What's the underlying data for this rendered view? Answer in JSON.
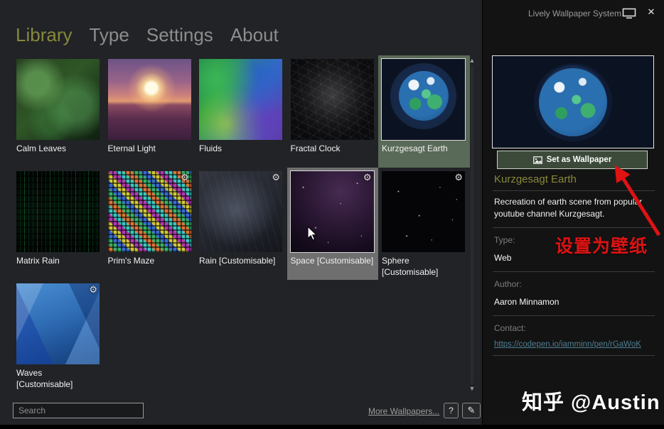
{
  "window": {
    "title": "Lively Wallpaper System"
  },
  "tabs": [
    {
      "label": "Library",
      "active": true
    },
    {
      "label": "Type",
      "active": false
    },
    {
      "label": "Settings",
      "active": false
    },
    {
      "label": "About",
      "active": false
    }
  ],
  "library": {
    "wallpapers": [
      {
        "name": "Calm Leaves",
        "style": "calm-leaves",
        "gear": false,
        "state": ""
      },
      {
        "name": "Eternal Light",
        "style": "eternal-light",
        "gear": false,
        "state": ""
      },
      {
        "name": "Fluids",
        "style": "fluids",
        "gear": false,
        "state": ""
      },
      {
        "name": "Fractal Clock",
        "style": "fractal-clock",
        "gear": false,
        "state": ""
      },
      {
        "name": "Kurzgesagt Earth",
        "style": "earth",
        "gear": false,
        "state": "selected"
      },
      {
        "name": "Matrix Rain",
        "style": "matrix-rain",
        "gear": false,
        "state": ""
      },
      {
        "name": "Prim's Maze",
        "style": "prims-maze",
        "gear": true,
        "state": ""
      },
      {
        "name": "Rain [Customisable]",
        "style": "rain",
        "gear": true,
        "state": ""
      },
      {
        "name": "Space [Customisable]",
        "style": "space",
        "gear": true,
        "state": "hover"
      },
      {
        "name": "Sphere [Customisable]",
        "style": "sphere",
        "gear": true,
        "state": ""
      },
      {
        "name": "Waves [Customisable]",
        "style": "waves",
        "gear": true,
        "state": ""
      }
    ]
  },
  "footer": {
    "search_placeholder": "Search",
    "more_link": "More Wallpapers...",
    "help_label": "?"
  },
  "detail_panel": {
    "set_button": "Set as Wallpaper",
    "title": "Kurzgesagt Earth",
    "description": "Recreation of earth scene from popular youtube channel Kurzgesagt.",
    "type_label": "Type:",
    "type_value": "Web",
    "author_label": "Author:",
    "author_value": "Aaron Minnamon",
    "contact_label": "Contact:",
    "contact_link": "https://codepen.io/iamminn/pen/rGaWoK"
  },
  "annotation": {
    "text": "设置为壁纸"
  },
  "watermark": {
    "text": "知乎 @Austin"
  },
  "icons": {
    "gear": "⚙",
    "scroll_up": "▲",
    "scroll_down": "▼",
    "close": "✕",
    "edit": "✎"
  },
  "colors": {
    "accent_olive": "#87893b",
    "selection_green": "#596a58",
    "hover_gray": "#6f6f6f",
    "annotation_red": "#e01212",
    "link_blue": "#4f7f93",
    "left_bg": "#212326",
    "right_bg": "#131313"
  }
}
